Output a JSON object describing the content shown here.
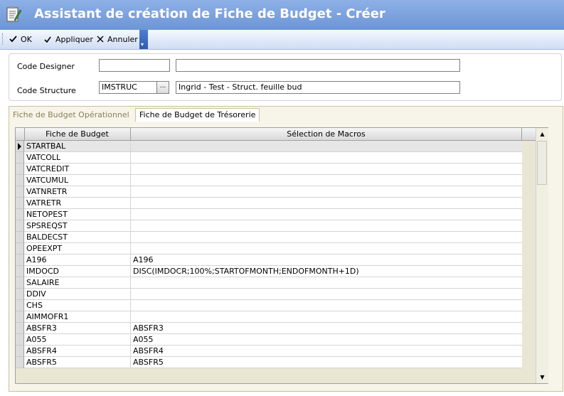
{
  "window": {
    "title": "Assistant de création de Fiche de Budget - Créer"
  },
  "toolbar": {
    "ok_label": "OK",
    "apply_label": "Appliquer",
    "cancel_label": "Annuler"
  },
  "form": {
    "code_designer_label": "Code Designer",
    "code_designer_value": "",
    "code_designer_desc": "",
    "code_structure_label": "Code Structure",
    "code_structure_value": "IMSTRUC",
    "code_structure_lookup": "...",
    "code_structure_desc": "Ingrid - Test - Struct. feuille bud"
  },
  "tabs": [
    {
      "label": "Fiche de Budget Opérationnel",
      "active": false
    },
    {
      "label": "Fiche de Budget de Trésorerie",
      "active": true
    }
  ],
  "grid": {
    "columns": [
      "Fiche de Budget",
      "Sélection de Macros"
    ],
    "rows": [
      {
        "budget": "STARTBAL",
        "macro": ""
      },
      {
        "budget": "VATCOLL",
        "macro": ""
      },
      {
        "budget": "VATCREDIT",
        "macro": ""
      },
      {
        "budget": "VATCUMUL",
        "macro": ""
      },
      {
        "budget": "VATNRETR",
        "macro": ""
      },
      {
        "budget": "VATRETR",
        "macro": ""
      },
      {
        "budget": "NETOPEST",
        "macro": ""
      },
      {
        "budget": "SPSREQST",
        "macro": ""
      },
      {
        "budget": "BALDECST",
        "macro": ""
      },
      {
        "budget": "OPEEXPT",
        "macro": ""
      },
      {
        "budget": "A196",
        "macro": "A196"
      },
      {
        "budget": "IMDOCD",
        "macro": "DISC(IMDOCR;100%;STARTOFMONTH;ENDOFMONTH+1D)"
      },
      {
        "budget": "SALAIRE",
        "macro": ""
      },
      {
        "budget": "DDIV",
        "macro": ""
      },
      {
        "budget": "CHS",
        "macro": ""
      },
      {
        "budget": "AIMMOFR1",
        "macro": ""
      },
      {
        "budget": "ABSFR3",
        "macro": "ABSFR3"
      },
      {
        "budget": "A055",
        "macro": "A055"
      },
      {
        "budget": "ABSFR4",
        "macro": "ABSFR4"
      },
      {
        "budget": "ABSFR5",
        "macro": "ABSFR5"
      }
    ]
  },
  "icons": {
    "app": "document-edit-icon",
    "ok": "checkmark-icon",
    "apply": "checkmark-small-icon",
    "cancel": "x-icon",
    "row_pointer": "row-pointer-icon",
    "scroll_up": "scroll-up-arrow-icon",
    "scroll_down": "scroll-down-arrow-icon"
  }
}
